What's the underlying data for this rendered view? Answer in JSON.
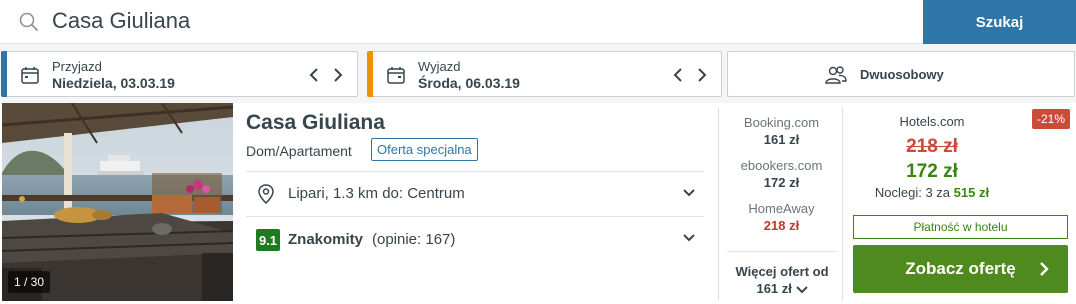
{
  "search": {
    "query": "Casa Giuliana",
    "button_label": "Szukaj"
  },
  "checkin": {
    "label": "Przyjazd",
    "value": "Niedziela, 03.03.19",
    "accent": "#2f76a8"
  },
  "checkout": {
    "label": "Wyjazd",
    "value": "Środa, 06.03.19",
    "accent": "#f29100"
  },
  "guests": {
    "label": "Dwuosobowy"
  },
  "hotel": {
    "photo_counter": "1 / 30",
    "name": "Casa Giuliana",
    "type": "Dom/Apartament",
    "badge": "Oferta specjalna",
    "location": "Lipari, 1.3 km do: Centrum",
    "rating_score": "9.1",
    "rating_word": "Znakomity",
    "rating_count": "(opinie: 167)"
  },
  "other_deals": [
    {
      "site": "Booking.com",
      "price": "161 zł",
      "highlight": false
    },
    {
      "site": "ebookers.com",
      "price": "172 zł",
      "highlight": false
    },
    {
      "site": "HomeAway",
      "price": "218 zł",
      "highlight": true
    }
  ],
  "more_offers": {
    "label": "Więcej ofert od",
    "price": "161 zł"
  },
  "main_offer": {
    "discount": "-21%",
    "site": "Hotels.com",
    "old_price": "218 zł",
    "new_price": "172 zł",
    "nights_prefix": "Noclegi: 3 za",
    "nights_total": "515 zł",
    "pay_at_hotel": "Płatność w hotelu",
    "cta_label": "Zobacz ofertę"
  }
}
